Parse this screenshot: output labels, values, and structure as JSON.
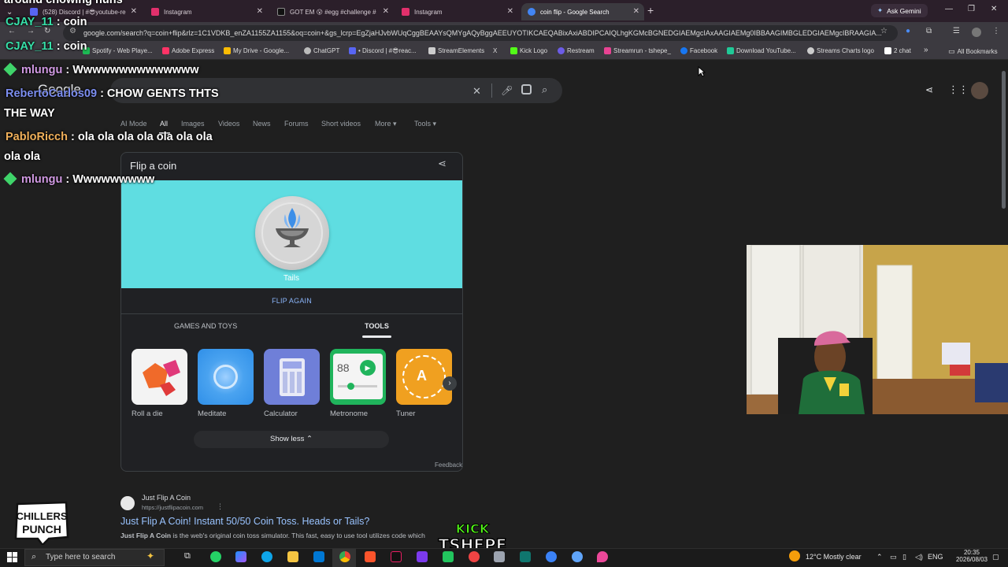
{
  "browser": {
    "tabs": [
      {
        "label": "(528) Discord | #😎youtube-re",
        "color": "#5865f2"
      },
      {
        "label": "Instagram",
        "color": "#e1306c"
      },
      {
        "label": "GOT EM 😮 #egg #challenge #",
        "color": "#111111"
      },
      {
        "label": "Instagram",
        "color": "#e1306c"
      },
      {
        "label": "coin flip - Google Search",
        "color": "#4285f4"
      }
    ],
    "new_tab": "+",
    "ask_gemini": "Ask Gemini",
    "url": "google.com/search?q=coin+flip&rlz=1C1VDKB_enZA1155ZA1155&oq=coin+&gs_lcrp=EgZjaHJvbWUqCggBEAAYsQMYgAQyBggAEEUYOTIKCAEQABixAxiABDIPCAIQLhgKGMcBGNEDGIAEMgcIAxAAGIAEMg0IBBAAGIMBGLEDGIAEMgcIBRAAGIA...",
    "bookmarks": [
      {
        "label": "Spotify - Web Playe...",
        "color": "#1db954"
      },
      {
        "label": "Adobe Express",
        "color": "#ff3366"
      },
      {
        "label": "My Drive - Google...",
        "color": "#fbbc04"
      },
      {
        "label": "ChatGPT",
        "color": "#bbbbbb"
      },
      {
        "label": "• Discord | #😎reac...",
        "color": "#5865f2"
      },
      {
        "label": "StreamElements",
        "color": "#cccccc"
      },
      {
        "label": "X",
        "color": "#ffffff"
      },
      {
        "label": "Kick Logo",
        "color": "#53fc18"
      },
      {
        "label": "Restream",
        "color": "#6c5ce7"
      },
      {
        "label": "Streamrun - tshepe_",
        "color": "#e84393"
      },
      {
        "label": "Facebook",
        "color": "#1877f2"
      },
      {
        "label": "Download YouTube...",
        "color": "#20c997"
      },
      {
        "label": "Streams Charts logo",
        "color": "#cccccc"
      },
      {
        "label": "2 chat",
        "color": "#ffffff"
      }
    ],
    "bookmarks_more": "»",
    "all_bookmarks": "All Bookmarks"
  },
  "google": {
    "logo": "Google",
    "nav_tabs": [
      "AI Mode",
      "All",
      "Images",
      "Videos",
      "News",
      "Forums",
      "Short videos",
      "More ▾",
      "Tools ▾"
    ],
    "coin_widget": {
      "title": "Flip a coin",
      "result": "Tails",
      "flip_again": "FLIP AGAIN",
      "categories": [
        "GAMES AND TOYS",
        "TOOLS"
      ],
      "tools": [
        {
          "label": "Roll a die",
          "color": "#f3f3f3"
        },
        {
          "label": "Meditate",
          "color": "#2f8fe8"
        },
        {
          "label": "Calculator",
          "color": "#6f7fd8"
        },
        {
          "label": "Metronome",
          "color": "#20b45c"
        },
        {
          "label": "Tuner",
          "color": "#f0a020"
        }
      ],
      "metronome_bpm": "88",
      "tuner_note": "A",
      "show_less": "Show less",
      "feedback": "Feedback"
    },
    "result": {
      "site": "Just Flip A Coin",
      "url": "https://justflipacoin.com",
      "title": "Just Flip A Coin! Instant 50/50 Coin Toss. Heads or Tails?",
      "snippet_bold": "Just Flip A Coin",
      "snippet": " is the web's original coin toss simulator. This fast, easy to use tool utilizes code which"
    }
  },
  "chat": [
    {
      "user": "",
      "message": "around chowing nuns",
      "class": ""
    },
    {
      "user": "CJAY_11",
      "message": ": coin",
      "class": "u-cjay"
    },
    {
      "user": "CJAY_11",
      "message": ": coin",
      "class": "u-cjay"
    },
    {
      "user": "mlungu",
      "message": ": Wwwwwwwwwwwwww",
      "class": "u-mlungu"
    },
    {
      "user": "RebertoCarlos09",
      "message": ": CHOW GENTS THTS",
      "class": "u-roberto"
    },
    {
      "user": "",
      "message": "THE WAY",
      "class": ""
    },
    {
      "user": "PabloRicch",
      "message": ": ola ola ola ola ola ola ola",
      "class": "u-pablo"
    },
    {
      "user": "",
      "message": "ola ola",
      "class": ""
    },
    {
      "user": "mlungu",
      "message": ": Wwwwwwwww",
      "class": "u-mlungu"
    }
  ],
  "overlay": {
    "chillers_line1": "CHILLERS",
    "chillers_line2": "PUNCH",
    "kick": "KICK",
    "tshepe": "TSHEPE"
  },
  "taskbar": {
    "search_placeholder": "Type here to search",
    "weather": "12°C  Mostly clear",
    "lang": "ENG",
    "time": "20:35",
    "date": "2026/08/03"
  }
}
